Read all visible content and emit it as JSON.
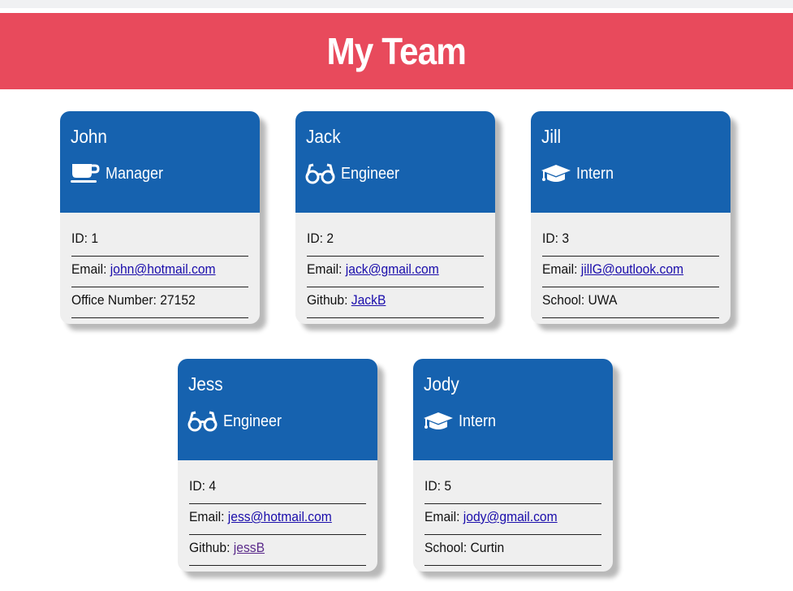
{
  "page": {
    "title": "My Team"
  },
  "team": [
    {
      "name": "John",
      "role": "Manager",
      "icon": "coffee-cup-icon",
      "id_label": "ID: 1",
      "email_label": "Email: ",
      "email": "john@hotmail.com",
      "extra_label": "Office Number: 27152",
      "extra_link": ""
    },
    {
      "name": "Jack",
      "role": "Engineer",
      "icon": "glasses-icon",
      "id_label": "ID: 2",
      "email_label": "Email: ",
      "email": "jack@gmail.com",
      "extra_label": "Github: ",
      "extra_link": "JackB"
    },
    {
      "name": "Jill",
      "role": "Intern",
      "icon": "graduation-cap-icon",
      "id_label": "ID: 3",
      "email_label": "Email: ",
      "email": "jillG@outlook.com",
      "extra_label": "School: UWA",
      "extra_link": ""
    },
    {
      "name": "Jess",
      "role": "Engineer",
      "icon": "glasses-icon",
      "id_label": "ID: 4",
      "email_label": "Email: ",
      "email": "jess@hotmail.com",
      "extra_label": "Github: ",
      "extra_link": "jessB"
    },
    {
      "name": "Jody",
      "role": "Intern",
      "icon": "graduation-cap-icon",
      "id_label": "ID: 5",
      "email_label": "Email: ",
      "email": "jody@gmail.com",
      "extra_label": "School: Curtin",
      "extra_link": ""
    }
  ],
  "colors": {
    "header_bg": "#e84a5c",
    "card_header_bg": "#1662af",
    "card_body_bg": "#efefef",
    "link": "#1a0dab"
  }
}
